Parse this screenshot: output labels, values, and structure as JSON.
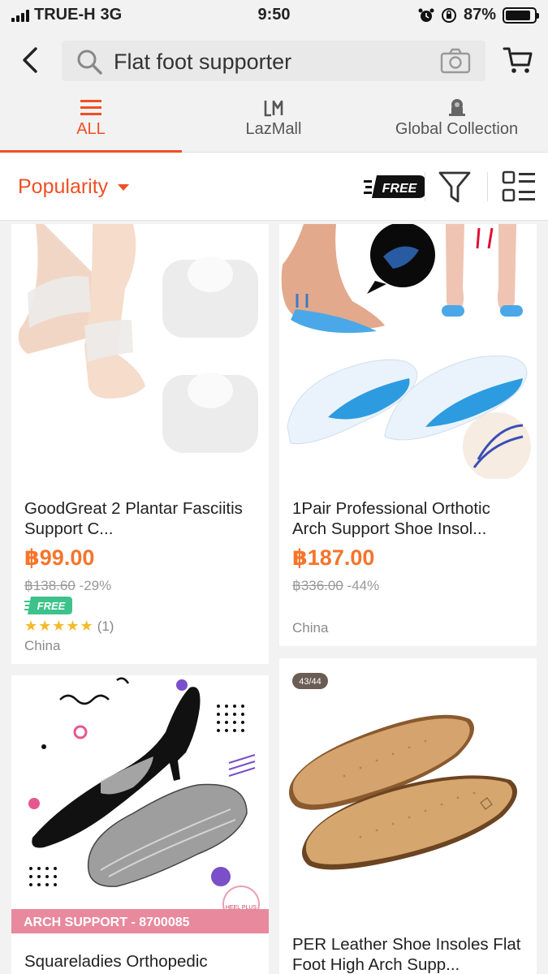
{
  "status": {
    "carrier": "TRUE-H",
    "network": "3G",
    "time": "9:50",
    "battery": "87%",
    "battery_level": 0.87
  },
  "search": {
    "query": "Flat foot supporter"
  },
  "tabs": [
    {
      "label": "ALL",
      "icon": "menu-icon",
      "active": true
    },
    {
      "label": "LazMall",
      "icon": "lazmall-logo-icon",
      "active": false
    },
    {
      "label": "Global Collection",
      "icon": "global-collection-icon",
      "active": false
    }
  ],
  "sortbar": {
    "sort_label": "Popularity",
    "free_label": "FREE"
  },
  "products": [
    {
      "title": "GoodGreat 2 Plantar Fasciitis Support C...",
      "price": "฿99.00",
      "original_price": "฿138.60",
      "discount": "-29%",
      "free_shipping": "FREE",
      "rating_stars": 5,
      "rating_count": "(1)",
      "origin": "China"
    },
    {
      "title": "1Pair Professional Orthotic Arch Support Shoe Insol...",
      "price": "฿187.00",
      "original_price": "฿336.00",
      "discount": "-44%",
      "origin": "China"
    },
    {
      "title": "Squareladies  Orthopedic",
      "banner": "ARCH SUPPORT - 8700085",
      "brand": "HEEL PLUS"
    },
    {
      "title": "PER Leather Shoe Insoles Flat Foot High Arch Supp...",
      "size_tag": "43/44"
    }
  ],
  "colors": {
    "accent": "#f04f24",
    "price": "#f5752a",
    "free_green": "#3cc28a",
    "star": "#f5b92a"
  }
}
